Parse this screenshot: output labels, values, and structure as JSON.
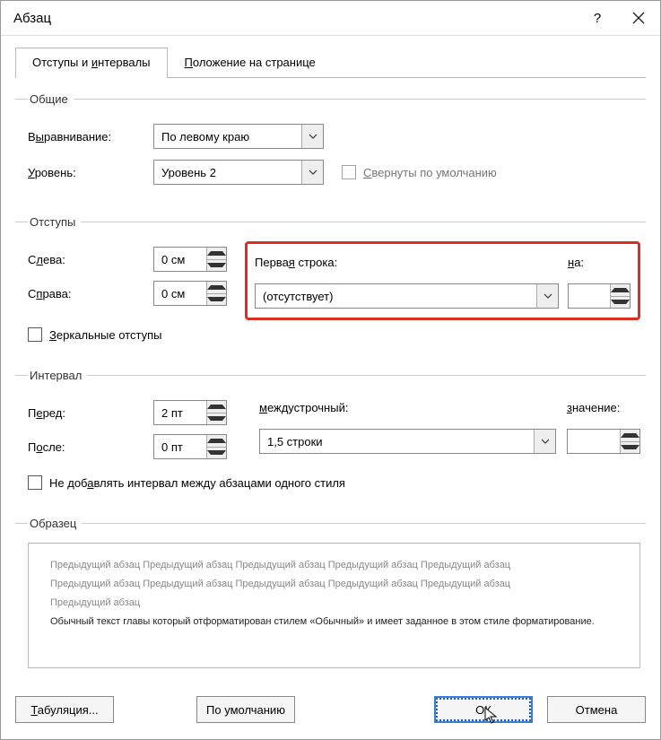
{
  "title": "Абзац",
  "help_char": "?",
  "tabs": {
    "indents": {
      "prefix": "Отступы и ",
      "ul": "и",
      "suffix": "нтервалы"
    },
    "position": {
      "prefix": "",
      "ul": "П",
      "suffix": "оложение на странице"
    }
  },
  "groups": {
    "general": {
      "legend": "Общие",
      "alignment_label_pre": "В",
      "alignment_label_ul": "ы",
      "alignment_label_post": "равнивание:",
      "alignment_value": "По левому краю",
      "level_label_pre": "",
      "level_label_ul": "У",
      "level_label_post": "ровень:",
      "level_value": "Уровень 2",
      "collapsed_pre": "",
      "collapsed_ul": "С",
      "collapsed_post": "вернуты по умолчанию"
    },
    "indent": {
      "legend": "Отступы",
      "left_pre": "С",
      "left_ul": "л",
      "left_post": "ева:",
      "left_value": "0 см",
      "right_pre": "С",
      "right_ul": "п",
      "right_post": "рава:",
      "right_value": "0 см",
      "first_pre": "Перва",
      "first_ul": "я",
      "first_post": " строка:",
      "first_value": "(отсутствует)",
      "by_pre": "",
      "by_ul": "н",
      "by_post": "а:",
      "by_value": "",
      "mirror_pre": "",
      "mirror_ul": "З",
      "mirror_post": "еркальные отступы"
    },
    "spacing": {
      "legend": "Интервал",
      "before_pre": "П",
      "before_ul": "е",
      "before_post": "ред:",
      "before_value": "2 пт",
      "after_pre": "П",
      "after_ul": "о",
      "after_post": "сле:",
      "after_value": "0 пт",
      "line_pre": "",
      "line_ul": "м",
      "line_post": "еждустрочный:",
      "line_value": "1,5 строки",
      "at_pre": "",
      "at_ul": "з",
      "at_post": "начение:",
      "at_value": "",
      "noadd_pre": "Не доб",
      "noadd_ul": "а",
      "noadd_post": "влять интервал между абзацами одного стиля"
    },
    "preview": {
      "legend": "Образец",
      "prev_text": "Предыдущий абзац Предыдущий абзац Предыдущий абзац Предыдущий абзац Предыдущий абзац",
      "prev_text2": "Предыдущий абзац Предыдущий абзац Предыдущий абзац Предыдущий абзац Предыдущий абзац",
      "prev_text3": "Предыдущий абзац",
      "current_text": "Обычный текст главы который отформатирован стилем «Обычный» и имеет заданное в этом стиле форматирование."
    }
  },
  "footer": {
    "tabs_pre": "",
    "tabs_ul": "Т",
    "tabs_post": "абуляция...",
    "default": "По умолчанию",
    "ok": "ОК",
    "cancel": "Отмена"
  }
}
